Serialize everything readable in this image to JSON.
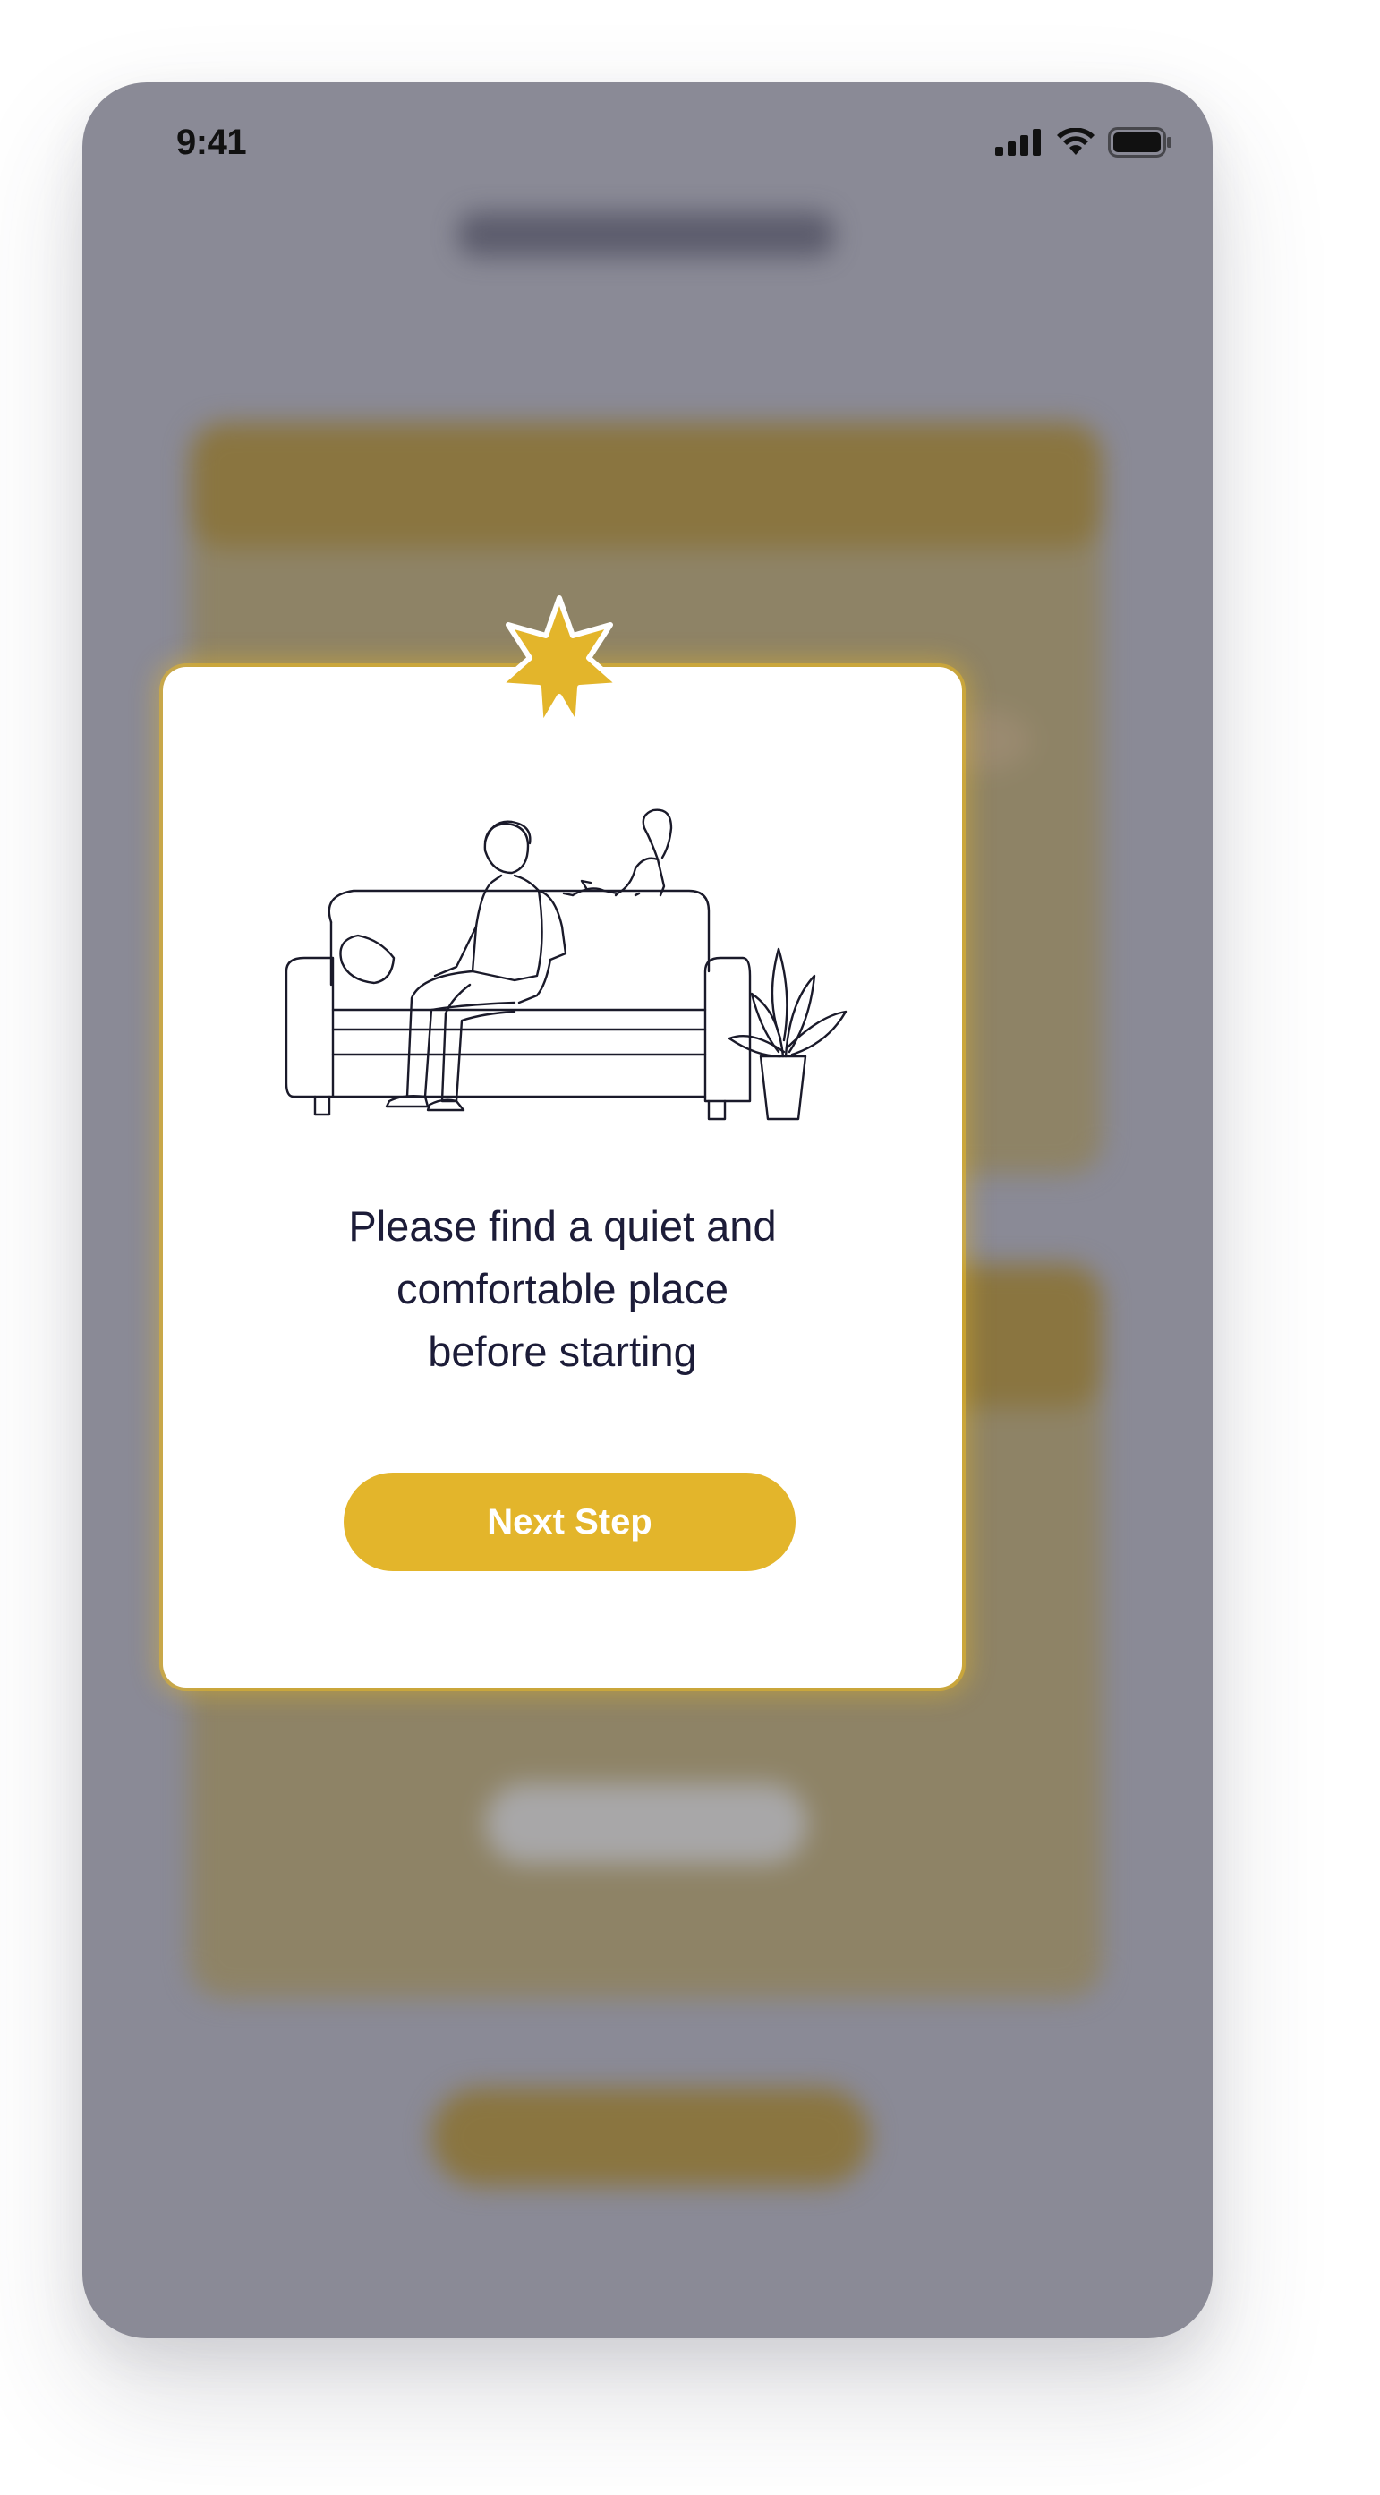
{
  "status_bar": {
    "time": "9:41",
    "icons": [
      "cellular-signal-icon",
      "wifi-icon",
      "battery-icon"
    ]
  },
  "modal": {
    "badge_icon": "star-burst-icon",
    "illustration": "person-on-sofa-with-cat-and-plant-illustration",
    "message": "Please find a quiet and\ncomfortable place\nbefore starting",
    "button_label": "Next Step"
  },
  "colors": {
    "accent": "#e3b52b",
    "overlay": "#8a8a96",
    "text": "#1c1c38",
    "modal_background": "#ffffff"
  }
}
